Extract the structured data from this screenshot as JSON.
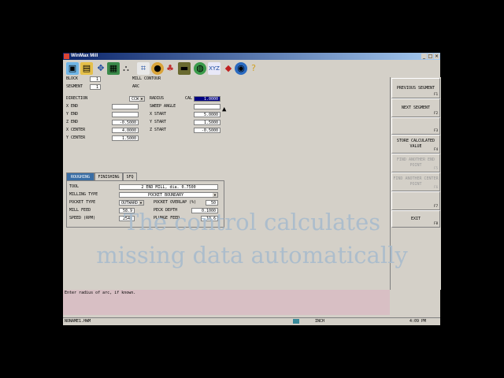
{
  "window": {
    "title": "WinMax Mill"
  },
  "window_buttons": [
    "_",
    "□",
    "×"
  ],
  "toolbar_icons": [
    "new-file-icon",
    "open-file-icon",
    "move-icon",
    "dimension-icon",
    "pocket-icon",
    "graph-icon",
    "tools-icon",
    "colors-icon",
    "materials-icon",
    "globe-icon",
    "settings-icon",
    "book-icon",
    "world-icon",
    "help-icon"
  ],
  "block": {
    "label": "BLOCK",
    "value": "1",
    "type": "MILL CONTOUR"
  },
  "segment": {
    "label": "SEGMENT",
    "value": "1",
    "type": "ARC"
  },
  "direction": {
    "label": "DIRECTION",
    "value": "CCW"
  },
  "radius": {
    "label": "RADIUS",
    "cal": "CAL",
    "value": "1.0000"
  },
  "sweep": {
    "label": "SWEEP ANGLE"
  },
  "x_end": {
    "label": "X END",
    "value": ""
  },
  "y_end": {
    "label": "Y END",
    "value": ""
  },
  "z_end": {
    "label": "Z END",
    "value": "-0.5000"
  },
  "x_center": {
    "label": "X CENTER",
    "value": "4.0000"
  },
  "y_center": {
    "label": "Y CENTER",
    "value": "1.5000"
  },
  "x_start": {
    "label": "X START",
    "value": "5.0000"
  },
  "y_start": {
    "label": "Y START",
    "value": "1.5000"
  },
  "z_start": {
    "label": "Z START",
    "value": "-0.5000"
  },
  "tabs": [
    "ROUGHING",
    "FINISHING",
    "SFQ"
  ],
  "roughing": {
    "tool_label": "TOOL",
    "tool_value": "2 END MILL, dia. 0.7500",
    "milling_type_label": "MILLING TYPE",
    "milling_type_value": "POCKET BOUNDARY",
    "pocket_type_label": "POCKET TYPE",
    "pocket_type_value": "OUTWARD",
    "pocket_overlap_label": "POCKET OVERLAP (%)",
    "pocket_overlap_value": "50",
    "mill_feed_label": "MILL FEED",
    "mill_feed_value": "58.9",
    "peck_depth_label": "PECK DEPTH",
    "peck_depth_value": "0.1000",
    "speed_label": "SPEED (RPM)",
    "speed_value": "2546",
    "plunge_feed_label": "PLUNGE FEED",
    "plunge_feed_value": "19.6"
  },
  "softkeys": [
    {
      "label": "PREVIOUS SEGMENT",
      "key": "F1",
      "enabled": true
    },
    {
      "label": "NEXT SEGMENT",
      "key": "F2",
      "enabled": true
    },
    {
      "label": "",
      "key": "F3",
      "enabled": true
    },
    {
      "label": "STORE CALCULATED VALUE",
      "key": "F4",
      "enabled": true
    },
    {
      "label": "FIND ANOTHER END POINT",
      "key": "F5",
      "enabled": false
    },
    {
      "label": "FIND ANOTHER CENTER POINT",
      "key": "F6",
      "enabled": false
    },
    {
      "label": "",
      "key": "F7",
      "enabled": true
    },
    {
      "label": "EXIT",
      "key": "F8",
      "enabled": true
    }
  ],
  "message": "Enter radius of arc, if known.",
  "status": {
    "file": "NONAME1.HWM",
    "units": "INCH",
    "time": "4:09 PM"
  },
  "overlay": {
    "line1": "The control calculates",
    "line2": "missing data automatically"
  },
  "colors": {
    "title_bar": "#0a246a",
    "selected_tab": "#3a6ea5",
    "message_bg": "#d8bfc4",
    "overlay_text": "#a9bccd"
  }
}
